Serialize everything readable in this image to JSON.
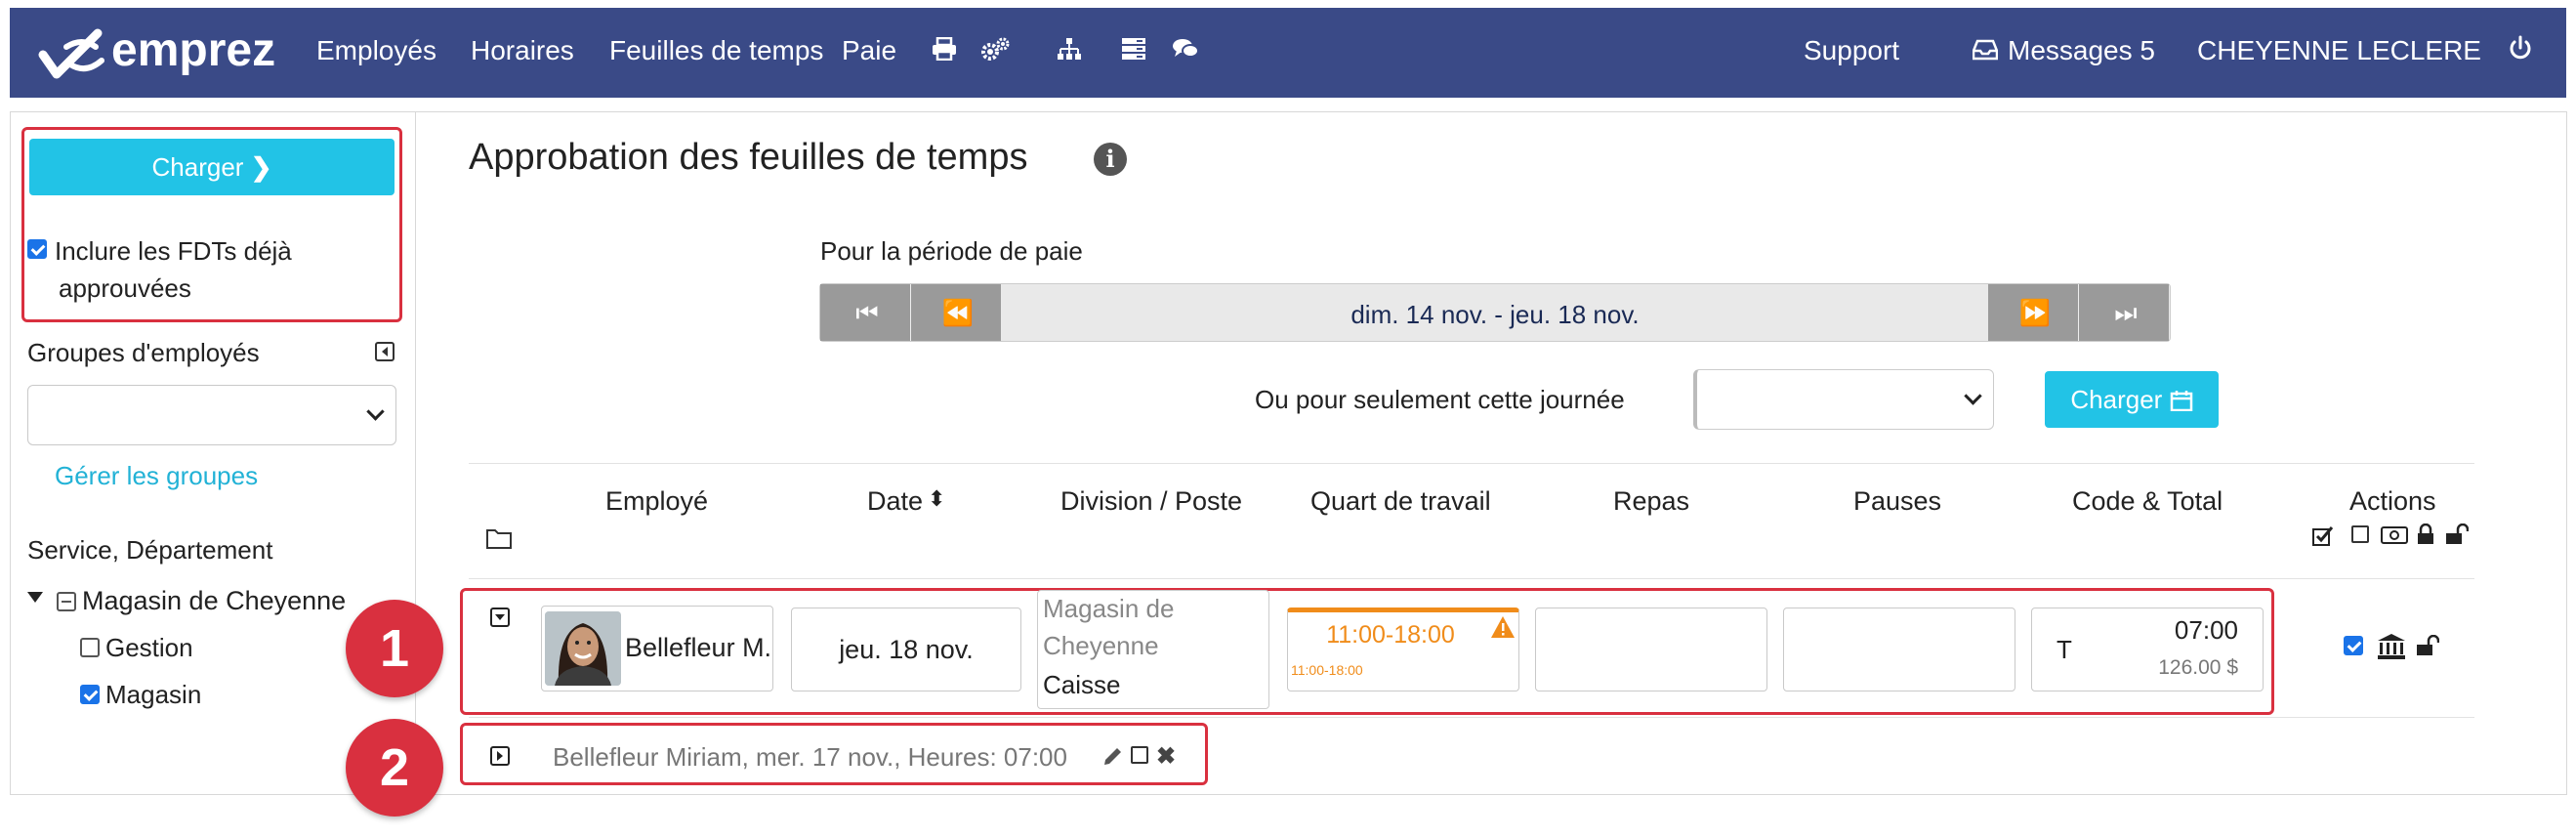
{
  "nav": {
    "brand": "emprez",
    "items": [
      "Employés",
      "Horaires",
      "Feuilles de temps",
      "Paie"
    ],
    "icons": [
      "print-icon",
      "cogs-icon",
      "sitemap-icon",
      "server-icon",
      "comments-icon"
    ],
    "support": "Support",
    "messages": "Messages 5",
    "user": "CHEYENNE LECLERE",
    "power_icon": "power-icon"
  },
  "sidebar": {
    "load_button": "Charger",
    "include_approved_line1": "Inclure les FDTs déjà",
    "include_approved_line2": "approuvées",
    "include_approved_checked": true,
    "groups_label": "Groupes d'employés",
    "manage_groups": "Gérer les groupes",
    "service_label": "Service, Département",
    "tree": {
      "root": "Magasin de Cheyenne",
      "children": [
        {
          "label": "Gestion",
          "checked": false
        },
        {
          "label": "Magasin",
          "checked": true
        }
      ]
    }
  },
  "main": {
    "title": "Approbation des feuilles de temps",
    "period_label": "Pour la période de paie",
    "period_range": "dim. 14 nov. - jeu. 18 nov.",
    "day_label": "Ou pour seulement cette journée",
    "day_load_button": "Charger",
    "columns": [
      "Employé",
      "Date",
      "Division / Poste",
      "Quart de travail",
      "Repas",
      "Pauses",
      "Code & Total",
      "Actions"
    ]
  },
  "row": {
    "employee": "Bellefleur M.",
    "date": "jeu. 18 nov.",
    "division_line1": "Magasin de",
    "division_line2": "Cheyenne",
    "post": "Caisse",
    "shift": "11:00-18:00",
    "shift_small": "11:00-18:00",
    "code": "T",
    "total_hours": "07:00",
    "total_amount": "126.00 $",
    "approved": true
  },
  "collapsed_row": {
    "text": "Bellefleur Miriam, mer. 17 nov., Heures: 07:00"
  },
  "callouts": [
    "1",
    "2"
  ],
  "colors": {
    "nav_bg": "#3a4a87",
    "accent_cyan": "#22c3e6",
    "callout_red": "#d9303f",
    "shift_orange": "#f08c1a"
  }
}
